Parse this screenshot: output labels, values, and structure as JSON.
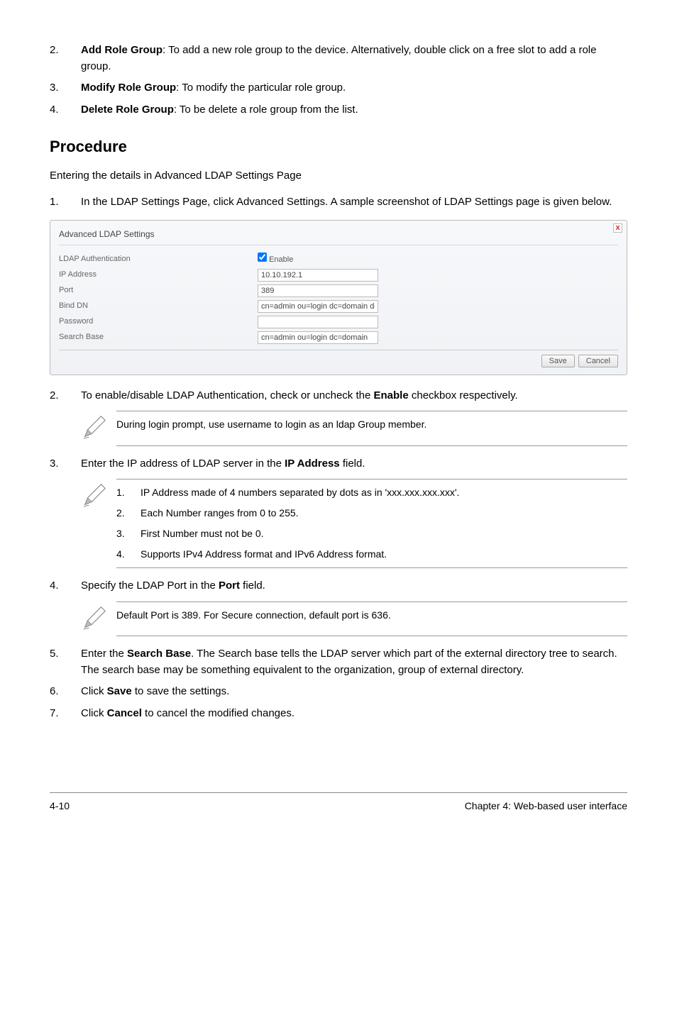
{
  "list1": {
    "item2": {
      "num": "2.",
      "label_bold": "Add Role Group",
      "label_rest": ": To add a new role group to the device. Alternatively, double click on a free slot to add a role group."
    },
    "item3": {
      "num": "3.",
      "label_bold": "Modify Role Group",
      "label_rest": ": To modify the particular role group."
    },
    "item4": {
      "num": "4.",
      "label_bold": "Delete Role Group",
      "label_rest": ": To be delete a role group from the list."
    }
  },
  "procedure_heading": "Procedure",
  "procedure_intro": "Entering the details in Advanced LDAP Settings Page",
  "step1": {
    "num": "1.",
    "text": "In the LDAP Settings Page, click Advanced Settings. A sample screenshot of LDAP Settings page is given below."
  },
  "screenshot": {
    "title": "Advanced LDAP Settings",
    "rows": {
      "ldap_auth": {
        "label": "LDAP Authentication",
        "checkbox_label": "Enable"
      },
      "ip": {
        "label": "IP Address",
        "value": "10.10.192.1"
      },
      "port": {
        "label": "Port",
        "value": "389"
      },
      "binddn": {
        "label": "Bind DN",
        "value": "cn=admin ou=login dc=domain dc="
      },
      "password": {
        "label": "Password",
        "value": ""
      },
      "searchbase": {
        "label": "Search Base",
        "value": "cn=admin ou=login dc=domain"
      }
    },
    "buttons": {
      "save": "Save",
      "cancel": "Cancel"
    }
  },
  "step2": {
    "num": "2.",
    "pre": "To enable/disable LDAP Authentication, check or uncheck the ",
    "bold": "Enable",
    "post": " checkbox respectively."
  },
  "note2": "During login prompt, use username to login as an ldap Group member.",
  "step3": {
    "num": "3.",
    "pre": "Enter the IP address of LDAP server in the ",
    "bold": "IP Address",
    "post": " field."
  },
  "note3": {
    "i1": {
      "num": "1.",
      "text": "IP Address made of 4 numbers separated by dots as in 'xxx.xxx.xxx.xxx'."
    },
    "i2": {
      "num": "2.",
      "text": "Each Number ranges from 0 to 255."
    },
    "i3": {
      "num": "3.",
      "text": "First Number must not be 0."
    },
    "i4": {
      "num": "4.",
      "text": "Supports IPv4 Address format and IPv6 Address format."
    }
  },
  "step4": {
    "num": "4.",
    "pre": "Specify the LDAP Port in the ",
    "bold": "Port",
    "post": " field."
  },
  "note4": "Default Port is 389. For Secure connection, default port is 636.",
  "step5": {
    "num": "5.",
    "pre": "Enter the ",
    "bold": "Search Base",
    "post": ". The Search base tells the LDAP server which part of the external directory tree to search. The search base may be something equivalent to the organization, group of external directory."
  },
  "step6": {
    "num": "6.",
    "pre": "Click ",
    "bold": "Save",
    "post": " to save the settings."
  },
  "step7": {
    "num": "7.",
    "pre": "Click ",
    "bold": "Cancel",
    "post": " to cancel the modified changes."
  },
  "footer": {
    "left": "4-10",
    "right": "Chapter 4: Web-based user interface"
  }
}
